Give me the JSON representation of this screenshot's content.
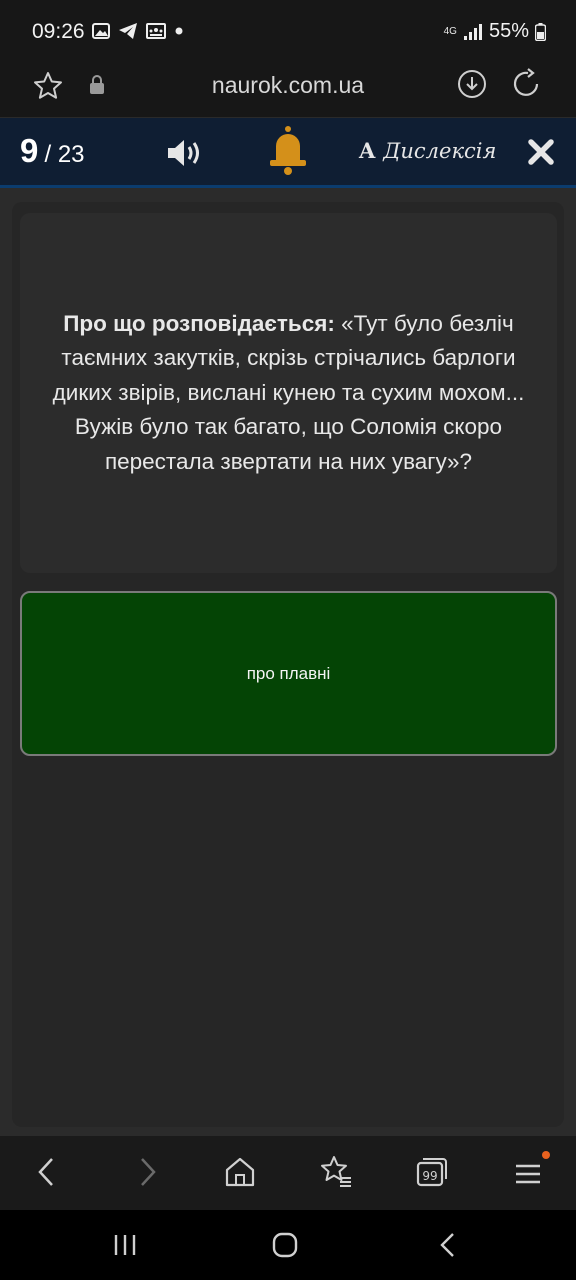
{
  "status_bar": {
    "time": "09:26",
    "network": "4G",
    "battery": "55%"
  },
  "browser": {
    "url": "naurok.com.ua"
  },
  "quiz_header": {
    "current": "9",
    "total": "/ 23",
    "dyslexia_letter": "A",
    "dyslexia_label": "Дислексія",
    "bell_color": "#d4901a"
  },
  "question": {
    "prefix": "Про що розповідається:",
    "text": "«Тут було безліч таємних закутків, скрізь стрічались барлоги диких звірів, вислані кунею та сухим мохом... Вужів було так багато, що Соломія скоро перестала звертати на них увагу»?"
  },
  "answer": {
    "label": "про плавні",
    "bg_color": "#044405"
  }
}
